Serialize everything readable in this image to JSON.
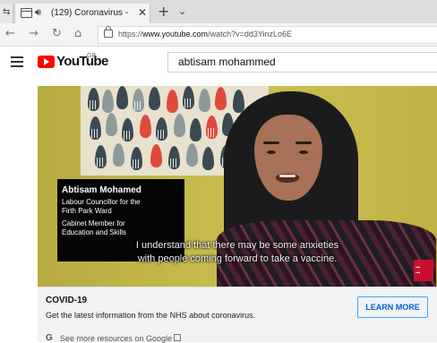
{
  "browser": {
    "tab_title": "(129) Coronavirus -",
    "tab_close": "✕",
    "new_tab": "+",
    "tab_menu": "⌄",
    "back": "←",
    "forward": "→",
    "refresh": "↻",
    "home": "⌂",
    "url_scheme": "https://",
    "url_host": "www.youtube.com",
    "url_path": "/watch?v=dd3YinzLo6E"
  },
  "youtube": {
    "logo_text": "YouTube",
    "region": "GB",
    "search_value": "abtisam mohammed"
  },
  "video": {
    "name": "Abtisam Mohamed",
    "title_line1": "Labour Councillor for the",
    "title_line2": "Firth Park Ward",
    "title_line3": "Cabinet Member for",
    "title_line4": "Education and Skills",
    "caption_line1": "I understand that there may be some anxieties",
    "caption_line2": "with people coming forward to take a vaccine."
  },
  "info_panel": {
    "title": "COVID-19",
    "text": "Get the latest information from the NHS about coronavirus.",
    "button": "LEARN MORE",
    "google_glyph": "G",
    "more_link": "See more resources on Google"
  },
  "colors": {
    "youtube_red": "#ff0000",
    "link_blue": "#065fd4",
    "button_border": "#3ea6ff",
    "wall": "#c4b646",
    "panel_bg": "#f2f2f2"
  },
  "icons": [
    "tab-page-icon",
    "speaker-icon",
    "close-icon",
    "plus-icon",
    "chevron-down-icon",
    "back-arrow-icon",
    "forward-arrow-icon",
    "refresh-icon",
    "home-icon",
    "lock-icon",
    "hamburger-icon",
    "youtube-play-icon",
    "external-link-icon"
  ]
}
